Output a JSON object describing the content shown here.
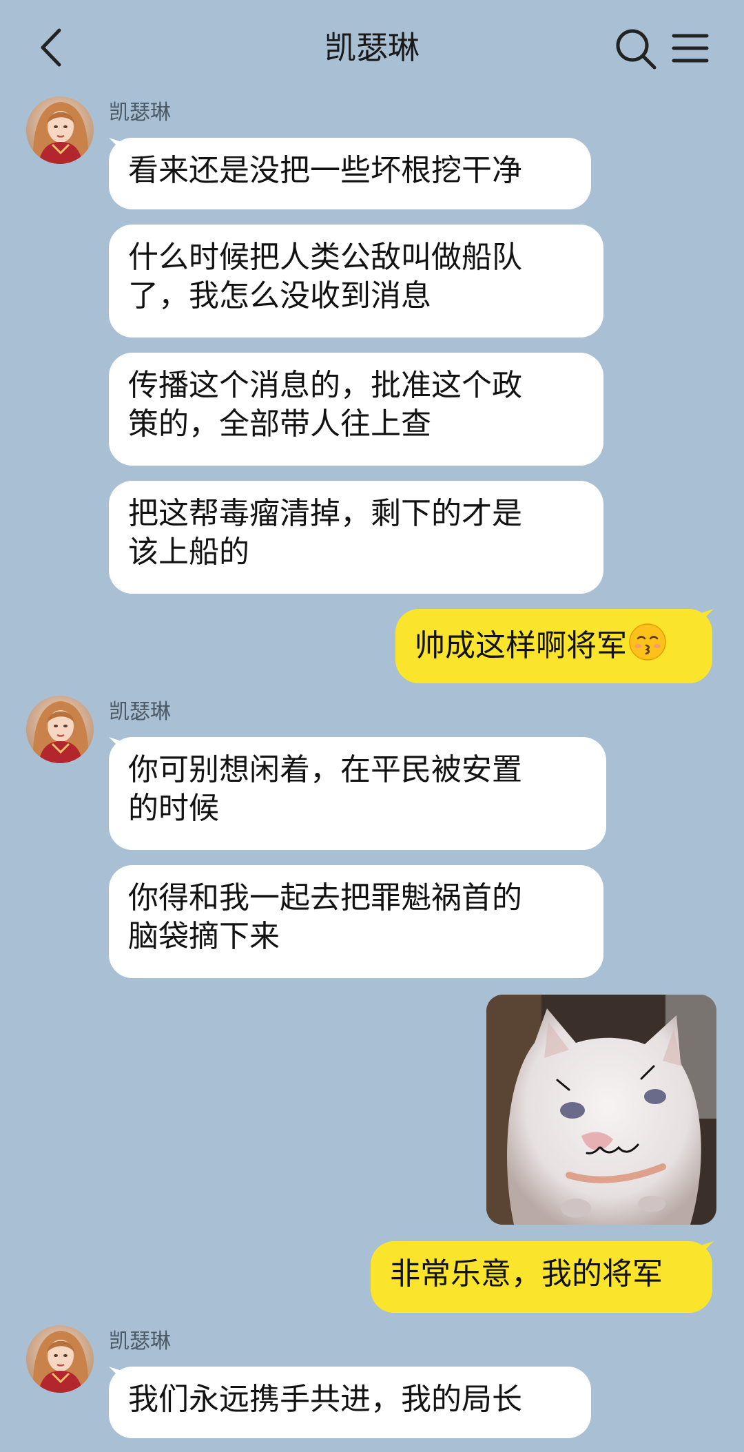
{
  "header": {
    "title": "凯瑟琳",
    "back_icon": "chevron-left-icon",
    "search_icon": "search-icon",
    "menu_icon": "hamburger-menu-icon"
  },
  "contact": {
    "name": "凯瑟琳"
  },
  "messages": [
    {
      "from": "contact",
      "text": "看来还是没把一些坏根挖干净"
    },
    {
      "from": "contact",
      "text": "什么时候把人类公敌叫做船队\n了，我怎么没收到消息"
    },
    {
      "from": "contact",
      "text": "传播这个消息的，批准这个政\n策的，全部带人往上查"
    },
    {
      "from": "contact",
      "text": "把这帮毒瘤清掉，剩下的才是\n该上船的"
    },
    {
      "from": "me",
      "text": "帅成这样啊将军",
      "emoji": "kissing-face-emoji"
    },
    {
      "from": "contact",
      "text": "你可别想闲着，在平民被安置\n的时候"
    },
    {
      "from": "contact",
      "text": "你得和我一起去把罪魁祸首的\n脑袋摘下来"
    },
    {
      "from": "me",
      "type": "sticker",
      "sticker": "smug-white-kitten-sticker"
    },
    {
      "from": "me",
      "text": "非常乐意，我的将军"
    },
    {
      "from": "contact",
      "text": "我们永远携手共进，我的局长"
    }
  ],
  "colors": {
    "background": "#a9bfd3",
    "incoming_bubble": "#ffffff",
    "outgoing_bubble": "#fbe52c"
  }
}
